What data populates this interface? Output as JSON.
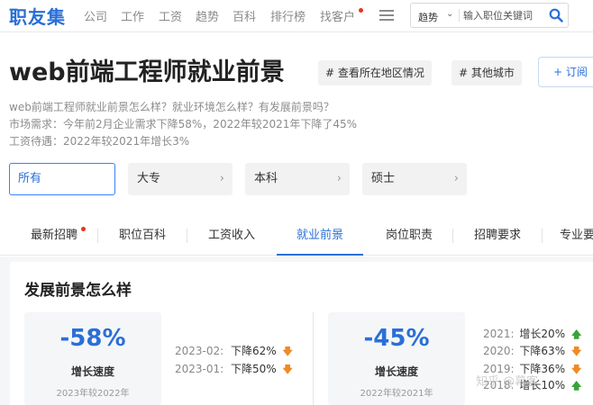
{
  "nav": {
    "logo": "职友集",
    "links": [
      "公司",
      "工作",
      "工资",
      "趋势",
      "百科",
      "排行榜",
      "找客户"
    ],
    "search_category": "趋势",
    "search_placeholder": "输入职位关键词"
  },
  "header": {
    "title": "web前端工程师就业前景",
    "tag_location": "# 查看所在地区情况",
    "tag_city": "# 其他城市",
    "subscribe": "+ 订阅"
  },
  "description": {
    "line1": "web前端工程师就业前景怎么样？就业环境怎么样？有发展前景吗？",
    "line2": "市场需求：今年前2月企业需求下降58%，2022年较2021年下降了45%",
    "line3": "工资待遇：2022年较2021年增长3%"
  },
  "education": {
    "options": [
      "所有",
      "大专",
      "本科",
      "硕士"
    ],
    "selected": "所有"
  },
  "tabs": [
    "最新招聘",
    "职位百科",
    "工资收入",
    "就业前景",
    "岗位职责",
    "招聘要求",
    "专业要"
  ],
  "active_tab": "就业前景",
  "section": {
    "title": "发展前景怎么样"
  },
  "stats": [
    {
      "value": "-58%",
      "label": "增长速度",
      "note": "2023年较2022年",
      "trend": [
        {
          "year": "2023-02:",
          "text": "下降62%",
          "direction": "down"
        },
        {
          "year": "2023-01:",
          "text": "下降50%",
          "direction": "down"
        }
      ]
    },
    {
      "value": "-45%",
      "label": "增长速度",
      "note": "2022年较2021年",
      "trend": [
        {
          "year": "2021:",
          "text": "增长20%",
          "direction": "up"
        },
        {
          "year": "2020:",
          "text": "下降63%",
          "direction": "down"
        },
        {
          "year": "2019:",
          "text": "下降36%",
          "direction": "down"
        },
        {
          "year": "2018:",
          "text": "增长10%",
          "direction": "up"
        }
      ]
    }
  ],
  "watermark": "知乎 @幕客",
  "colors": {
    "accent": "#2a6fd6",
    "down": "#f08a24",
    "up": "#3aa33a",
    "notification": "#e8341c"
  }
}
